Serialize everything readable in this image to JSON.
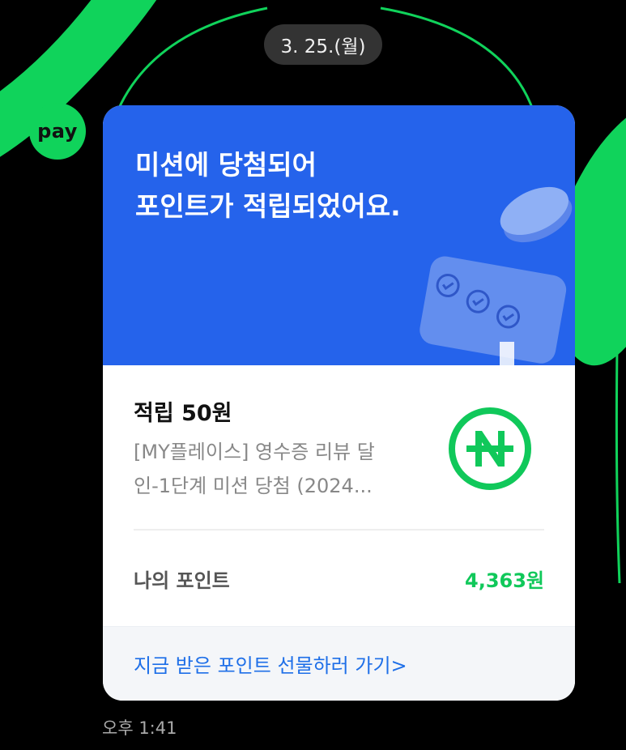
{
  "date_divider": "3. 25.(월)",
  "sender": {
    "avatar_text": "pay"
  },
  "card": {
    "hero_title_line1": "미션에 당첨되어",
    "hero_title_line2": "포인트가 적립되었어요.",
    "earn_title": "적립 50원",
    "earn_desc_line1": "[MY플레이스] 영수증 리뷰 달",
    "earn_desc_line2": "인-1단계 미션 당첨 (2024...",
    "points_label": "나의 포인트",
    "points_value": "4,363원",
    "footer_link": "지금 받은 포인트 선물하러 가기>"
  },
  "message_time": "오후 1:41",
  "colors": {
    "background": "#000000",
    "brand_green": "#10d35b",
    "hero_blue": "#2563eb",
    "point_green": "#10c85a",
    "link_blue": "#1e6fe8"
  },
  "icons": [
    "pay-logo",
    "coin-illustration",
    "naver-point-icon"
  ]
}
